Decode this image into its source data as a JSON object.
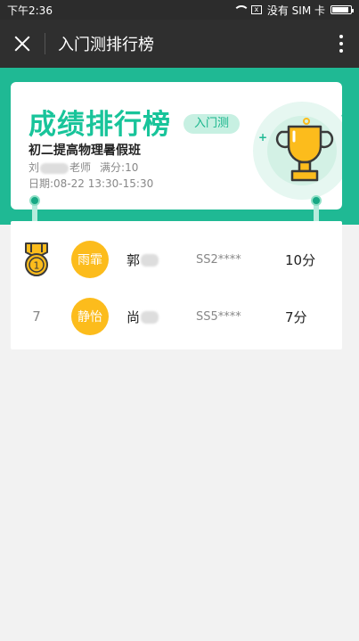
{
  "status_bar": {
    "time": "下午2:36",
    "no_sim_text": "没有 SIM 卡",
    "sim_icon_label": "x",
    "battery_level": 0.9
  },
  "app_bar": {
    "title": "入门测排行榜",
    "close_icon": "close-icon",
    "more_icon": "more-vertical-icon"
  },
  "header": {
    "banner_title": "成绩排行榜",
    "exam_tag": "入门测",
    "class_name": "初二提高物理暑假班",
    "teacher_prefix": "刘",
    "teacher_suffix": "老师",
    "full_score": "满分:10",
    "date": "日期:08-22 13:30-15:30"
  },
  "colors": {
    "teal": "#1fb994",
    "avatar_bg": "#fcbc1c",
    "trophy": "#fcbc1c"
  },
  "rankings": [
    {
      "rank": "1",
      "avatar_text": "雨霏",
      "name": "郭",
      "student_id": "SS2****",
      "score": "10分",
      "medal": "gold-medal-icon"
    },
    {
      "rank": "7",
      "avatar_text": "静怡",
      "name": "尚",
      "student_id": "SS5****",
      "score": "7分"
    }
  ]
}
